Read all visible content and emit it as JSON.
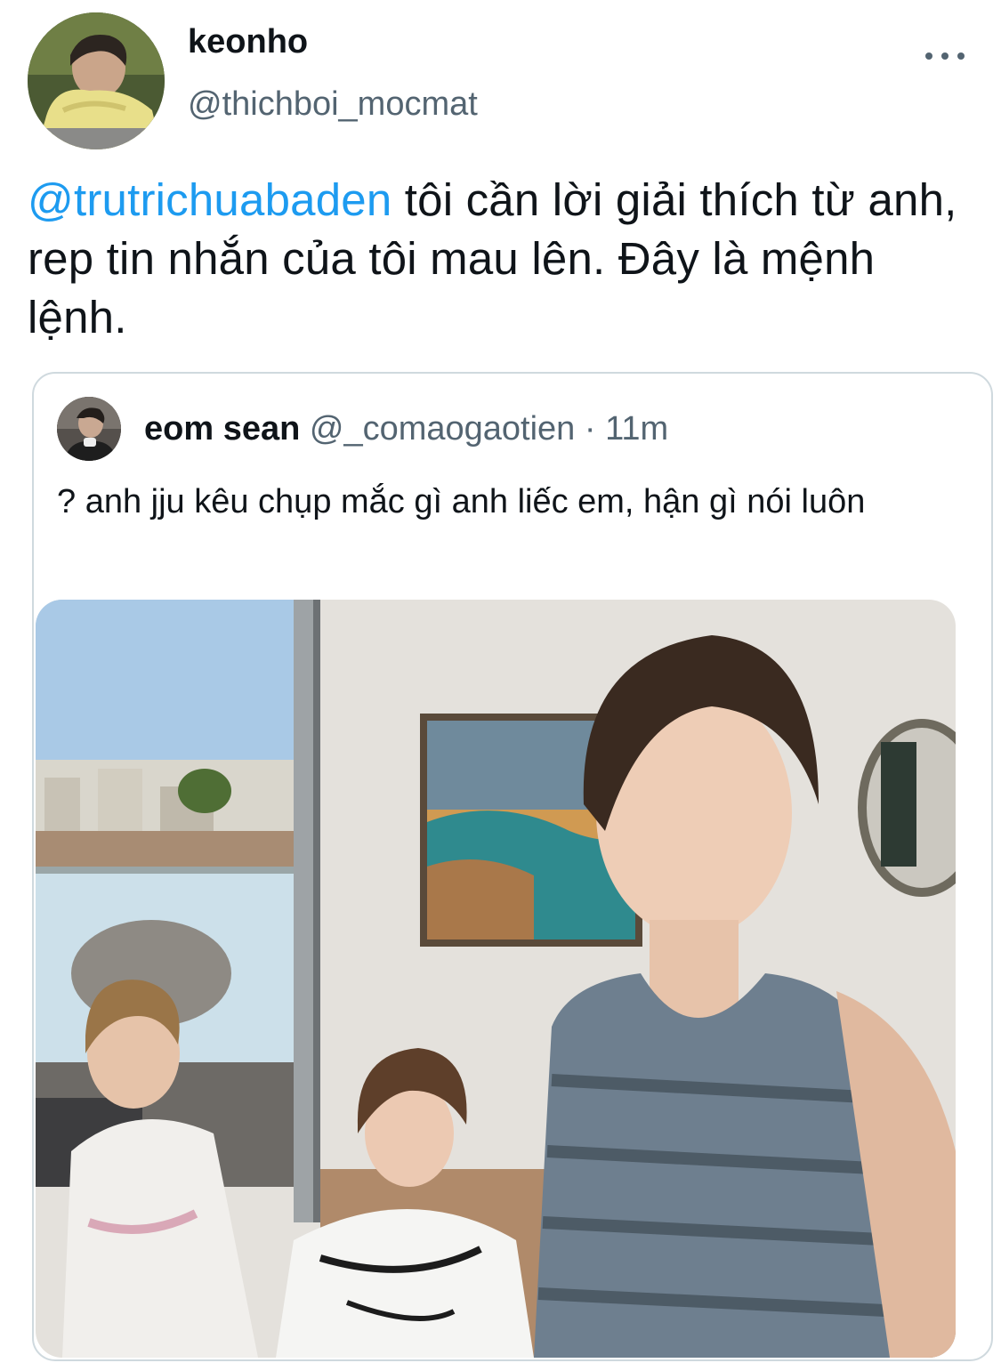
{
  "tweet": {
    "author": {
      "display_name": "keonho",
      "handle": "@thichboi_mocmat"
    },
    "mention": "@trutrichuabaden",
    "text": " tôi cần lời giải thích từ anh, rep tin nhắn của tôi mau lên. Đây là mệnh lệnh."
  },
  "quote": {
    "author": {
      "display_name": "eom sean",
      "handle": "@_comaogaotien",
      "separator": "·",
      "time": "11m"
    },
    "text": "? anh jju kêu chụp mắc gì anh liếc em, hận gì nói luôn"
  },
  "icons": {
    "more": "more-horizontal-icon"
  },
  "colors": {
    "mention": "#1d9bf0",
    "secondary_text": "#536471",
    "primary_text": "#0f1419",
    "card_border": "#cfd9de"
  }
}
